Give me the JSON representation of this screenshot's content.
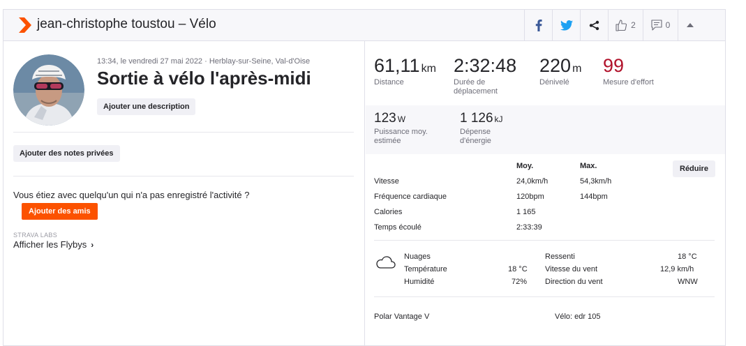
{
  "header": {
    "title": "jean-christophe toustou – Vélo",
    "kudos_count": "2",
    "comments_count": "0"
  },
  "activity": {
    "meta": "13:34, le vendredi 27 mai 2022 · Herblay-sur-Seine, Val-d'Oise",
    "title": "Sortie à vélo l'après-midi",
    "add_description": "Ajouter une description",
    "add_private_notes": "Ajouter des notes privées",
    "with_prompt": "Vous étiez avec quelqu'un qui n'a pas enregistré l'activité ?",
    "add_friends": "Ajouter des amis",
    "labs_label": "STRAVA LABS",
    "flyby_link": "Afficher les Flybys"
  },
  "stats": {
    "distance": {
      "value": "61,11",
      "unit": "km",
      "label": "Distance"
    },
    "moving_time": {
      "value": "2:32:48",
      "label": "Durée de déplacement"
    },
    "elevation": {
      "value": "220",
      "unit": "m",
      "label": "Dénivelé"
    },
    "effort": {
      "value": "99",
      "label": "Mesure d'effort"
    },
    "power": {
      "value": "123",
      "unit": "W",
      "label": "Puissance moy. estimée"
    },
    "energy": {
      "value": "1 126",
      "unit": "kJ",
      "label": "Dépense d'énergie"
    }
  },
  "details": {
    "col_avg": "Moy.",
    "col_max": "Max.",
    "reduce_button": "Réduire",
    "rows": [
      {
        "label": "Vitesse",
        "avg": "24,0km/h",
        "max": "54,3km/h"
      },
      {
        "label": "Fréquence cardiaque",
        "avg": "120bpm",
        "max": "144bpm"
      },
      {
        "label": "Calories",
        "avg": "1 165",
        "max": ""
      },
      {
        "label": "Temps écoulé",
        "avg": "2:33:39",
        "max": ""
      }
    ]
  },
  "weather": {
    "icon": "cloud-icon",
    "condition": "Nuages",
    "temperature_label": "Température",
    "temperature_value": "18 °C",
    "humidity_label": "Humidité",
    "humidity_value": "72%",
    "feels_label": "Ressenti",
    "feels_value": "18 °C",
    "wind_speed_label": "Vitesse du vent",
    "wind_speed_value": "12,9 km/h",
    "wind_dir_label": "Direction du vent",
    "wind_dir_value": "WNW"
  },
  "footer": {
    "device": "Polar Vantage V",
    "bike": "Vélo: edr 105"
  },
  "colors": {
    "brand": "#fc5200",
    "effort": "#b1122b",
    "facebook": "#3b5998",
    "twitter": "#1da1f2"
  }
}
